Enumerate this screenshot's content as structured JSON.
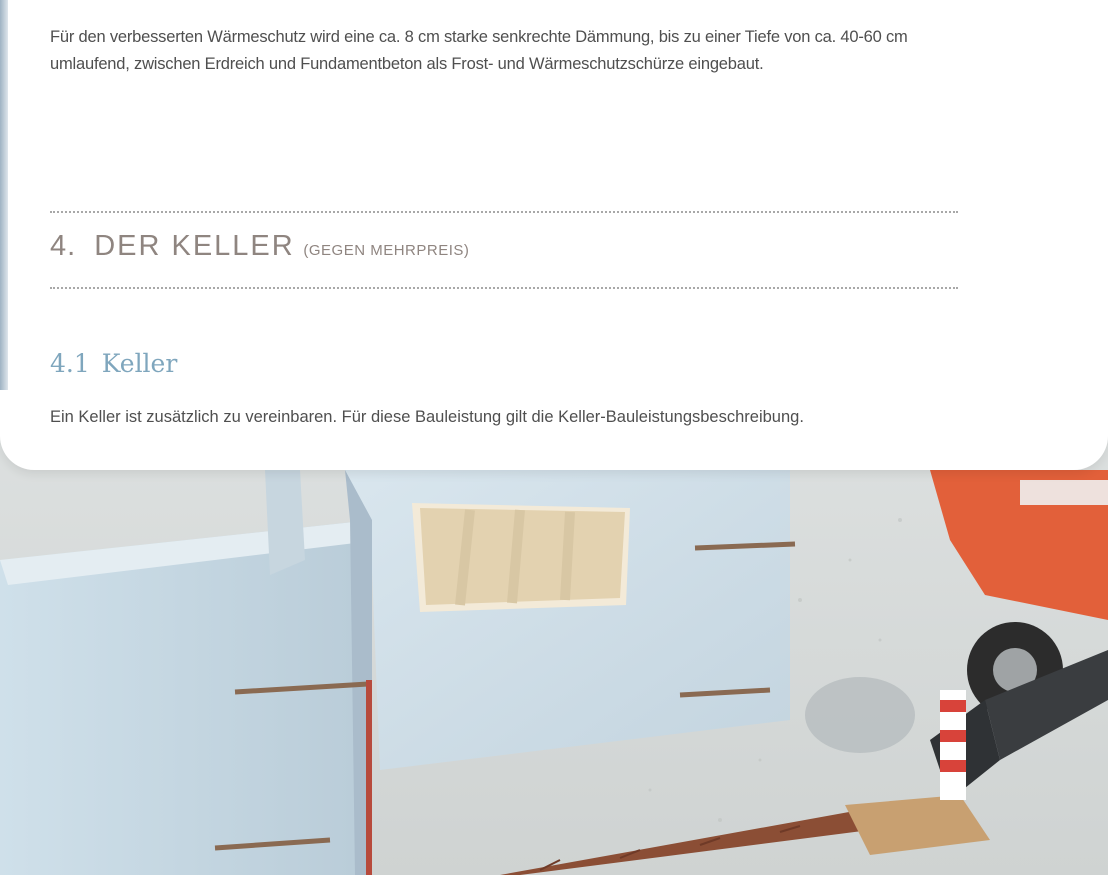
{
  "intro_paragraph": "Für den verbesserten Wärmeschutz wird eine ca. 8 cm starke senkrechte Dämmung, bis zu einer Tiefe von ca. 40-60 cm umlaufend, zwischen Erdreich und Fundamentbeton als Frost- und Wärmeschutzschürze eingebaut.",
  "section": {
    "number": "4.",
    "title": "DER KELLER",
    "note": "(GEGEN MEHRPREIS)"
  },
  "subsection": {
    "number": "4.1",
    "title": "Keller",
    "body": "Ein Keller ist zusätzlich zu vereinbaren. Für diese Bauleistung gilt die Keller-Bauleistungsbeschreibung."
  },
  "colors": {
    "section_heading": "#8f8580",
    "sub_heading": "#7fa6bd",
    "body_text": "#4f4f4f",
    "truck_orange": "#e2603a"
  },
  "photo_description_icon": "construction-site-photo"
}
